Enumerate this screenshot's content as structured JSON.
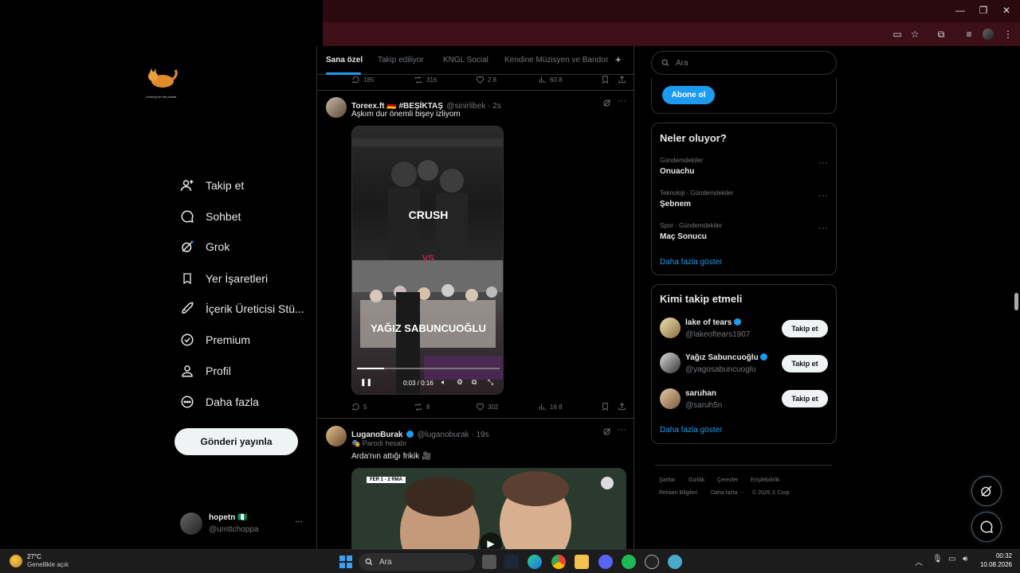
{
  "left_nav": {
    "logo_caption": "Looking for the planet",
    "items": [
      {
        "label": "Takip et",
        "icon": "person-add-icon"
      },
      {
        "label": "Sohbet",
        "icon": "chat-icon"
      },
      {
        "label": "Grok",
        "icon": "grok-icon"
      },
      {
        "label": "Yer İşaretleri",
        "icon": "bookmark-icon"
      },
      {
        "label": "İçerik Üreticisi Stü...",
        "icon": "rocket-icon"
      },
      {
        "label": "Premium",
        "icon": "premium-icon"
      },
      {
        "label": "Profil",
        "icon": "profile-icon"
      },
      {
        "label": "Daha fazla",
        "icon": "more-circle-icon"
      }
    ],
    "post_button": "Gönderi yayınla",
    "account": {
      "name": "hopetn 🇳🇬",
      "handle": "@umttchoppa",
      "more": "···"
    }
  },
  "main": {
    "tabs": [
      "Sana özel",
      "Takip ediliyor",
      "KNGL Social",
      "Kendine Müzisyen ve Bandos"
    ],
    "add_tab": "+",
    "prev_actions": {
      "replies": "185",
      "retweets": "316",
      "likes": "2 8",
      "views": "60 8"
    },
    "tweet1": {
      "name": "Toreex.ft 🇩🇪 #BEŞİKTAŞ",
      "handle": "@sinirlibek · 2s",
      "text": "Aşkım dur önemli bişey izliyom",
      "video": {
        "top_caption": "CRUSH",
        "vs": "VS",
        "bottom_caption": "YAĞIZ SABUNCUOĞLU",
        "time": "0:03 / 0:16",
        "progress": 0.19
      },
      "actions": {
        "replies": "5",
        "retweets": "8",
        "likes": "302",
        "views": "16 8"
      }
    },
    "tweet2": {
      "name": "LuganoBurak",
      "handle": "@luganoburak · 19s",
      "parody": "🎭 Parodi hesabı",
      "text": "Arda'nın attığı frikik 🎥",
      "score": "FER 1 - 2 RMA"
    }
  },
  "right": {
    "search_placeholder": "Ara",
    "subscribe_button": "Abone ol",
    "trends_title": "Neler oluyor?",
    "trends": [
      {
        "category": "Gündemdekiler",
        "name": "Onuachu"
      },
      {
        "category": "Teknoloji · Gündemdekiler",
        "name": "Şebnem"
      },
      {
        "category": "Spor · Gündemdekiler",
        "name": "Maç Sonucu"
      }
    ],
    "show_more": "Daha fazla göster",
    "who_title": "Kimi takip etmeli",
    "who": [
      {
        "name": "lake of tears",
        "handle": "@lakeoftears1907",
        "verified": true
      },
      {
        "name": "Yağız Sabuncuoğlu",
        "handle": "@yagosabuncuoglu",
        "verified": true
      },
      {
        "name": "saruhan",
        "handle": "@saruh5n",
        "verified": false
      }
    ],
    "follow_label": "Takip et",
    "footer": [
      "Şartlar",
      "Gizlilik",
      "Çerezler",
      "Erişilebilirlik",
      "Reklam Bilgileri",
      "Daha fazla ···",
      "© 2026 X Corp."
    ]
  },
  "taskbar": {
    "weather_temp": "27°C",
    "weather_desc": "Genellikle açık",
    "search_label": "Ara",
    "time": "00:32",
    "date": "10.08.2026"
  },
  "colors": {
    "accent": "#1d9bf0",
    "chrome": "#3a0f14",
    "bg": "#000000"
  }
}
